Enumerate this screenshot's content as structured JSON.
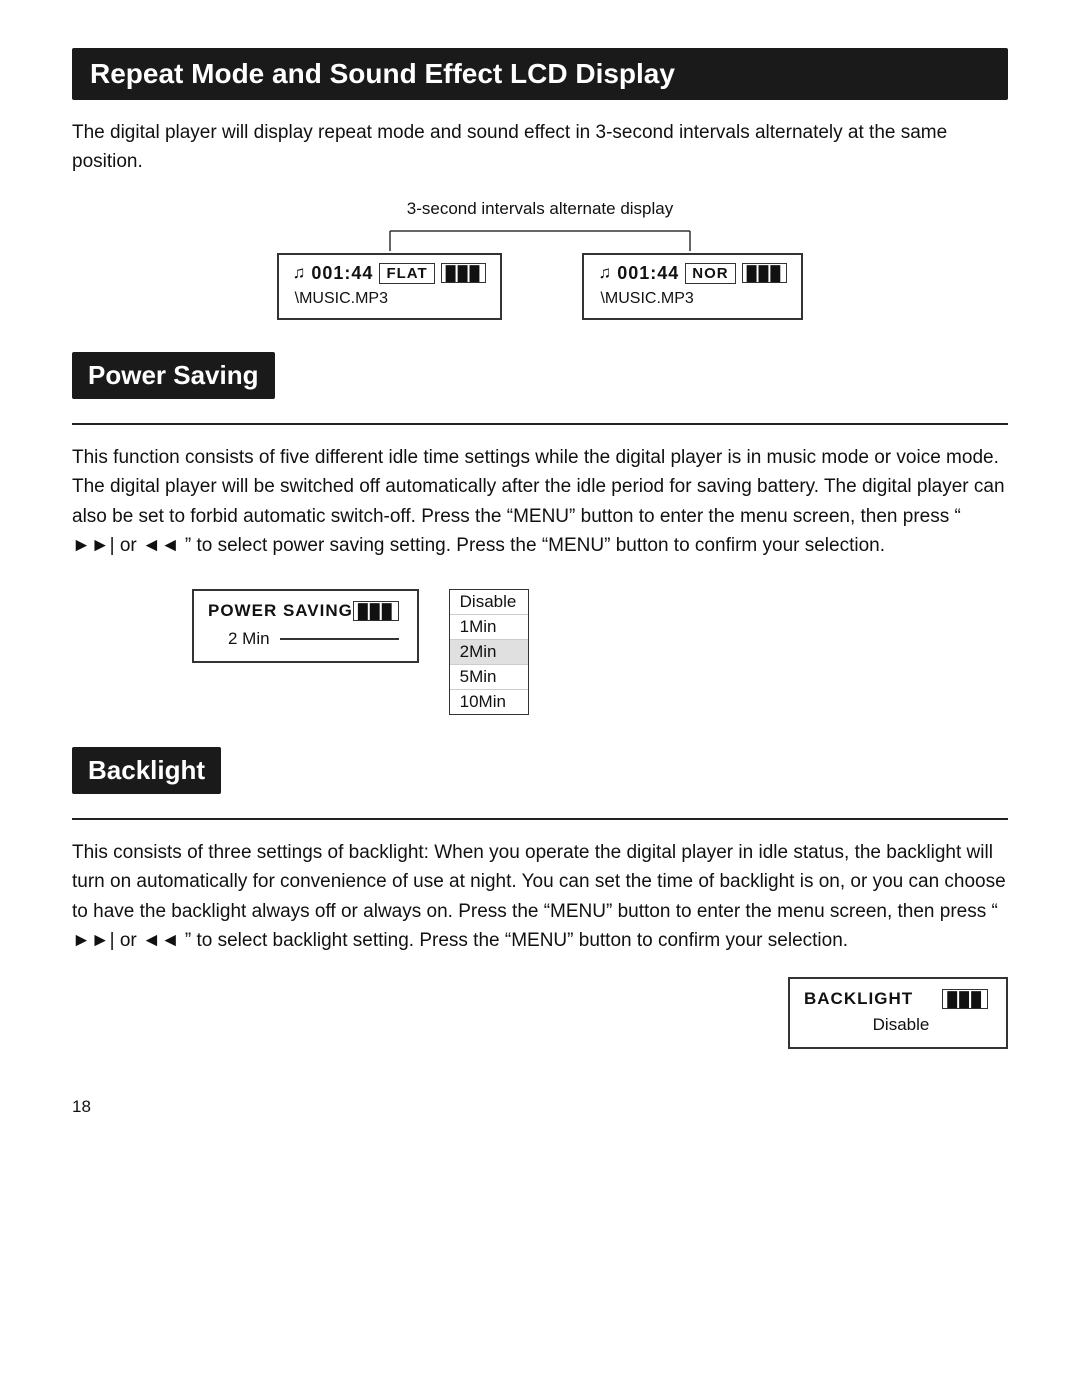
{
  "page": {
    "number": "18"
  },
  "repeat_mode_section": {
    "title": "Repeat Mode and Sound Effect LCD Display",
    "body": "The digital player will display repeat mode and sound effect in 3-second intervals alternately at the same position.",
    "diagram_label": "3-second intervals alternate display",
    "screen1": {
      "time": "001:44",
      "mode": "FLAT",
      "filename": "\\MUSIC.MP3"
    },
    "screen2": {
      "time": "001:44",
      "mode": "NOR",
      "filename": "\\MUSIC.MP3"
    }
  },
  "power_saving_section": {
    "title": "Power Saving",
    "body": "This function consists of five different idle time settings while the digital player is in music mode or voice mode. The digital player will be switched off automatically after the idle period for saving battery. The digital player can also be set to forbid automatic switch-off. Press the “MENU” button to enter the menu screen, then press “ ►►| or ◄◄ ” to select power saving setting. Press the “MENU” button to confirm your selection.",
    "screen": {
      "title": "POWER SAVING",
      "value": "2 Min"
    },
    "menu": {
      "items": [
        "Disable",
        "1Min",
        "2Min",
        "5Min",
        "10Min"
      ],
      "selected": "2Min"
    }
  },
  "backlight_section": {
    "title": "Backlight",
    "body": "This consists of three settings of backlight: When you operate the digital player in idle status, the backlight will turn on automatically for convenience of use at night. You can set the time of backlight is on, or you can choose to have the backlight always off or always on. Press the “MENU” button to enter the menu screen, then press “ ►►| or ◄◄ ” to select backlight setting. Press the “MENU” button to confirm your selection.",
    "screen": {
      "title": "BACKLIGHT",
      "value": "Disable"
    }
  },
  "icons": {
    "music_note": "🎵",
    "battery": "███",
    "forward": "►►|",
    "backward": "◄◄"
  }
}
